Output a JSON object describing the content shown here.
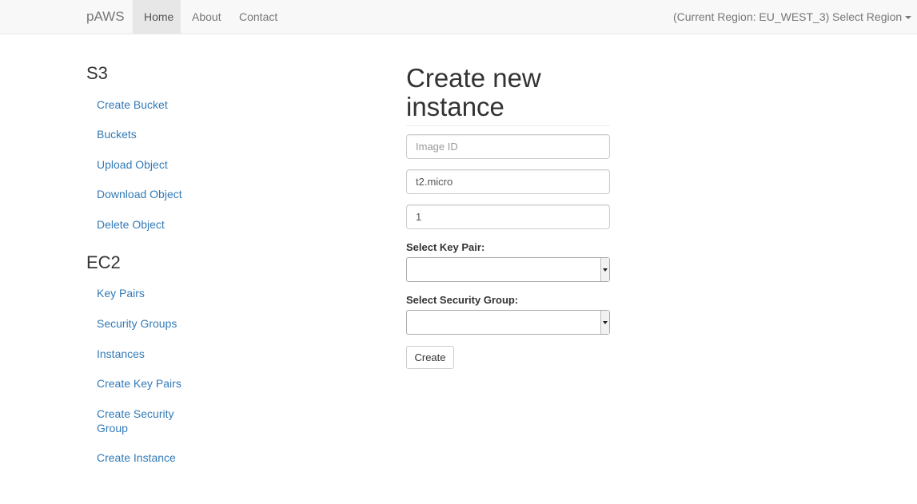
{
  "navbar": {
    "brand": "pAWS",
    "items": [
      {
        "label": "Home",
        "active": true
      },
      {
        "label": "About",
        "active": false
      },
      {
        "label": "Contact",
        "active": false
      }
    ],
    "current_region": "(Current Region: EU_WEST_3)",
    "select_region_label": "Select Region"
  },
  "sidebar": {
    "s3": {
      "title": "S3",
      "links": [
        "Create Bucket",
        "Buckets",
        "Upload Object",
        "Download Object",
        "Delete Object"
      ]
    },
    "ec2": {
      "title": "EC2",
      "links": [
        "Key Pairs",
        "Security Groups",
        "Instances",
        "Create Key Pairs",
        "Create Security Group",
        "Create Instance"
      ]
    }
  },
  "form": {
    "heading": "Create new instance",
    "image_id": {
      "placeholder": "Image ID",
      "value": ""
    },
    "instance_type": {
      "value": "t2.micro"
    },
    "count": {
      "value": "1"
    },
    "key_pair_label": "Select Key Pair:",
    "security_group_label": "Select Security Group:",
    "create_button": "Create"
  },
  "colors": {
    "link": "#337ab7",
    "navbar_bg": "#f8f8f8",
    "nav_active_bg": "#e7e7e7"
  }
}
